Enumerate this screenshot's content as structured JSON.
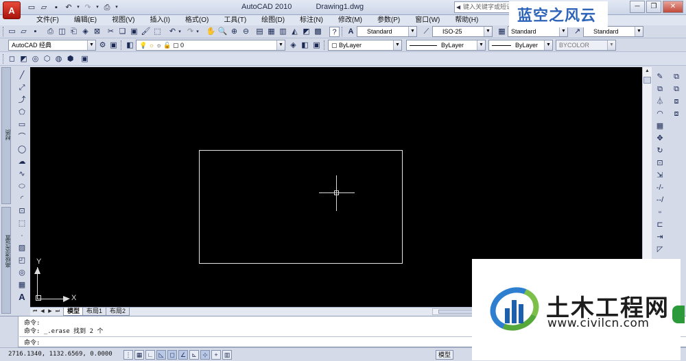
{
  "app": {
    "logo_letter": "A",
    "title": "AutoCAD 2010",
    "document": "Drawing1.dwg",
    "help_search_placeholder": "键入关键字或短语"
  },
  "menu": [
    "文件(F)",
    "编辑(E)",
    "视图(V)",
    "插入(I)",
    "格式(O)",
    "工具(T)",
    "绘图(D)",
    "标注(N)",
    "修改(M)",
    "参数(P)",
    "窗口(W)",
    "帮助(H)"
  ],
  "toolbar_styles": {
    "text_style": "Standard",
    "dim_style": "ISO-25",
    "table_style": "Standard",
    "multileader_style": "Standard"
  },
  "toolbar_layers": {
    "workspace": "AutoCAD 经典",
    "current_layer": "0",
    "color": "ByLayer",
    "linetype": "ByLayer",
    "lineweight": "ByLayer",
    "plotstyle": "BYCOLOR"
  },
  "left_palette": {
    "strip1_label": "材质",
    "strip2_label": "高级渲染设置"
  },
  "canvas": {
    "ucs_x_label": "X",
    "ucs_y_label": "Y"
  },
  "tabs": [
    "模型",
    "布局1",
    "布局2"
  ],
  "command_history": [
    "命令:",
    "命令: _.erase 找到 2 个"
  ],
  "command_prompt": "命令:",
  "status": {
    "coordinates": "2716.1340, 1132.6569, 0.0000",
    "model_label": "模型"
  },
  "watermarks": {
    "top": "蓝空之风云",
    "brand_cn": "土木工程网",
    "brand_url": "www.civilcn.com"
  },
  "colors": {
    "canvas_bg": "#000000",
    "ui_bg": "#d4dae8",
    "accent_blue": "#2d63b8",
    "autocad_red": "#c4261a"
  }
}
